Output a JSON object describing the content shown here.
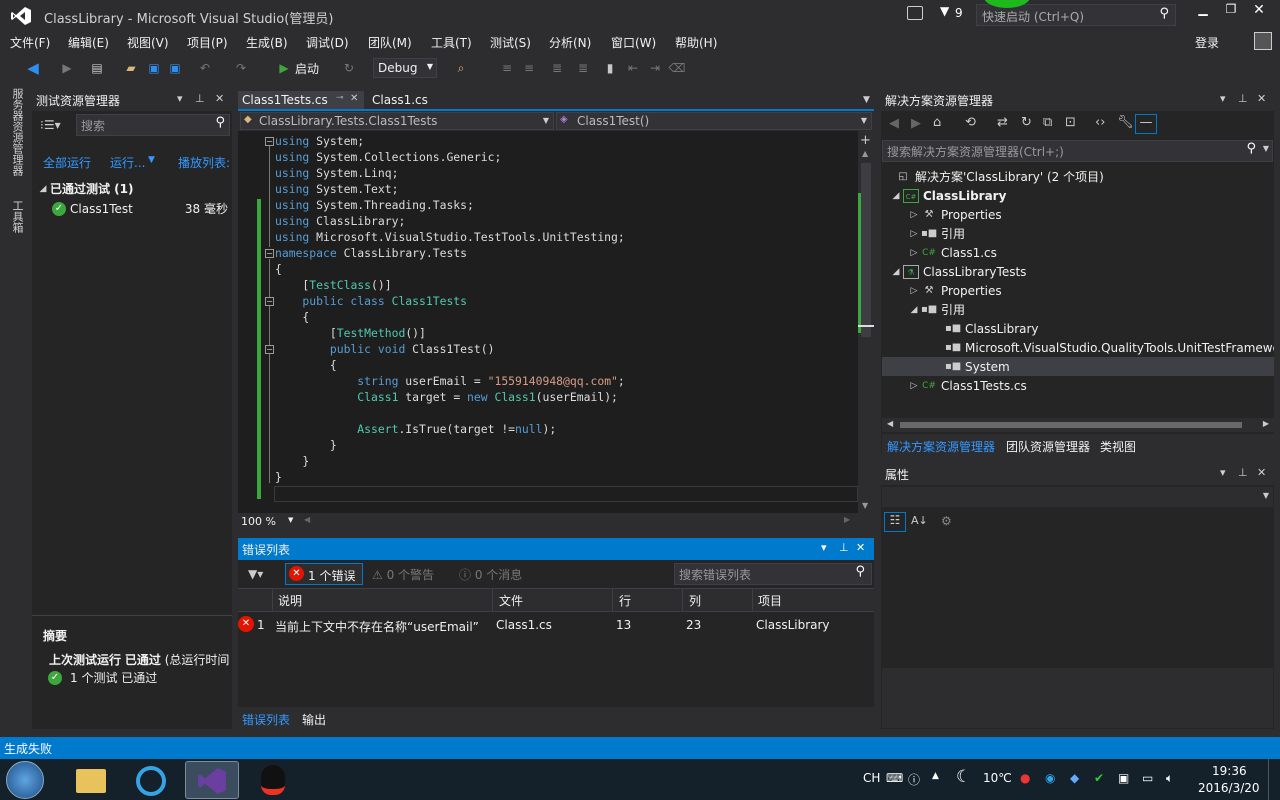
{
  "window": {
    "title": "ClassLibrary - Microsoft Visual Studio(管理员)",
    "notif_count": "9",
    "quick_launch_placeholder": "快速启动 (Ctrl+Q)",
    "login": "登录"
  },
  "menu": [
    "文件(F)",
    "编辑(E)",
    "视图(V)",
    "项目(P)",
    "生成(B)",
    "调试(D)",
    "团队(M)",
    "工具(T)",
    "测试(S)",
    "分析(N)",
    "窗口(W)",
    "帮助(H)"
  ],
  "toolbar": {
    "start_label": "启动",
    "config": "Debug"
  },
  "side_tabs": [
    "服务器资源管理器",
    "工具箱"
  ],
  "test_explorer": {
    "title": "测试资源管理器",
    "search_placeholder": "搜索",
    "run_all": "全部运行",
    "run": "运行...",
    "playlist": "播放列表:",
    "group_label": "已通过测试 (1)",
    "test_name": "Class1Test",
    "test_time": "38 毫秒",
    "summary_title": "摘要",
    "last_run_prefix": "上次测试运行",
    "last_run_status": "已通过",
    "last_run_suffix": "(总运行时间",
    "passed_summary": "1 个测试 已通过"
  },
  "editor": {
    "tabs": [
      {
        "label": "Class1Tests.cs",
        "active": true
      },
      {
        "label": "Class1.cs",
        "active": false
      }
    ],
    "nav_class": "ClassLibrary.Tests.Class1Tests",
    "nav_member": "Class1Test()",
    "zoom": "100 %",
    "code_lines": [
      [
        [
          "kw",
          "using"
        ],
        [
          "",
          "System;"
        ]
      ],
      [
        [
          "kw",
          "using"
        ],
        [
          "",
          "System.Collections.Generic;"
        ]
      ],
      [
        [
          "kw",
          "using"
        ],
        [
          "",
          "System.Linq;"
        ]
      ],
      [
        [
          "kw",
          "using"
        ],
        [
          "",
          "System.Text;"
        ]
      ],
      [
        [
          "kw",
          "using"
        ],
        [
          "",
          "System.Threading.Tasks;"
        ]
      ],
      [
        [
          "kw",
          "using"
        ],
        [
          "",
          "ClassLibrary;"
        ]
      ],
      [
        [
          "kw",
          "using"
        ],
        [
          "",
          "Microsoft.VisualStudio.TestTools.UnitTesting;"
        ]
      ],
      [
        [
          "kw",
          "namespace"
        ],
        [
          "",
          "ClassLibrary.Tests"
        ]
      ],
      [
        [
          "",
          "{"
        ]
      ],
      [
        [
          "",
          "    ["
        ],
        [
          "ty",
          "TestClass"
        ],
        [
          "",
          "()]"
        ]
      ],
      [
        [
          "kw",
          "    public class"
        ],
        [
          "ty",
          " Class1Tests"
        ]
      ],
      [
        [
          "",
          "    {"
        ]
      ],
      [
        [
          "",
          "        ["
        ],
        [
          "ty",
          "TestMethod"
        ],
        [
          "",
          "()]"
        ]
      ],
      [
        [
          "kw",
          "        public void"
        ],
        [
          "",
          " Class1Test()"
        ]
      ],
      [
        [
          "",
          "        {"
        ]
      ],
      [
        [
          "kw",
          "            string"
        ],
        [
          "",
          " userEmail = "
        ],
        [
          "st",
          "\"1559140948@qq.com\""
        ],
        [
          "",
          ";"
        ]
      ],
      [
        [
          "ty",
          "            Class1"
        ],
        [
          "",
          " target = "
        ],
        [
          "kw",
          "new"
        ],
        [
          "ty",
          " Class1"
        ],
        [
          "",
          "(userEmail);"
        ]
      ],
      [
        [
          "",
          ""
        ]
      ],
      [
        [
          "ty",
          "            Assert"
        ],
        [
          "",
          ".IsTrue(target !="
        ],
        [
          "kw",
          "null"
        ],
        [
          "",
          ");"
        ]
      ],
      [
        [
          "",
          "        }"
        ]
      ],
      [
        [
          "",
          "    }"
        ]
      ],
      [
        [
          "",
          "}"
        ]
      ]
    ]
  },
  "error_list": {
    "title": "错误列表",
    "errors_btn": "1 个错误",
    "warnings_btn": "0 个警告",
    "messages_btn": "0 个消息",
    "search_placeholder": "搜索错误列表",
    "columns": [
      "说明",
      "文件",
      "行",
      "列",
      "项目"
    ],
    "rows": [
      {
        "num": "1",
        "desc": "当前上下文中不存在名称“userEmail”",
        "file": "Class1.cs",
        "line": "13",
        "col": "23",
        "project": "ClassLibrary"
      }
    ],
    "bottom_tabs": [
      "错误列表",
      "输出"
    ]
  },
  "solution_explorer": {
    "title": "解决方案资源管理器",
    "search_placeholder": "搜索解决方案资源管理器(Ctrl+;)",
    "solution": "解决方案'ClassLibrary' (2 个项目)",
    "items": [
      {
        "label": "ClassLibrary",
        "bold": true
      },
      {
        "label": "Properties"
      },
      {
        "label": "引用"
      },
      {
        "label": "Class1.cs"
      },
      {
        "label": "ClassLibraryTests"
      },
      {
        "label": "Properties"
      },
      {
        "label": "引用"
      },
      {
        "label": "ClassLibrary"
      },
      {
        "label": "Microsoft.VisualStudio.QualityTools.UnitTestFramewo"
      },
      {
        "label": "System"
      },
      {
        "label": "Class1Tests.cs"
      }
    ],
    "bottom_tabs": [
      "解决方案资源管理器",
      "团队资源管理器",
      "类视图"
    ]
  },
  "properties": {
    "title": "属性"
  },
  "statusbar": {
    "text": "生成失败"
  },
  "taskbar": {
    "lang": "CH",
    "temp": "10℃",
    "time": "19:36",
    "date": "2016/3/20"
  },
  "colors": {
    "accent": "#007acc",
    "pass": "#3ca73c",
    "error": "#e51400"
  }
}
